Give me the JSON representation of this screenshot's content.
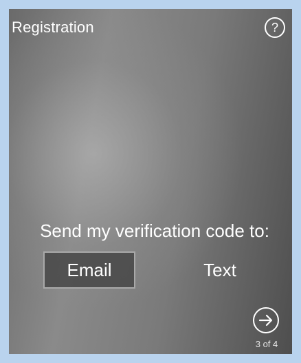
{
  "header": {
    "title": "Registration",
    "help_label": "?"
  },
  "main": {
    "prompt": "Send my verification code to:",
    "options": [
      {
        "label": "Email",
        "selected": true
      },
      {
        "label": "Text",
        "selected": false
      }
    ]
  },
  "footer": {
    "next_icon": "arrow-right-circle-icon",
    "pager": "3 of 4"
  },
  "colors": {
    "outer_frame": "#b9d3ee",
    "text": "#ffffff"
  }
}
